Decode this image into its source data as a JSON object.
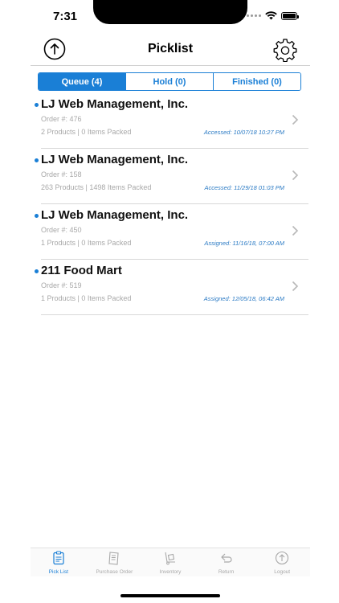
{
  "status_bar": {
    "time": "7:31"
  },
  "nav": {
    "title": "Picklist",
    "left_icon": "upload-icon",
    "right_icon": "gear-icon"
  },
  "segments": [
    {
      "label": "Queue (4)",
      "active": true
    },
    {
      "label": "Hold (0)",
      "active": false
    },
    {
      "label": "Finished (0)",
      "active": false
    }
  ],
  "orders": [
    {
      "name": "LJ Web Management, Inc.",
      "order": "Order #: 476",
      "counts": "2 Products | 0 Items Packed",
      "time": "Accessed: 10/07/18 10:27 PM"
    },
    {
      "name": "LJ Web Management, Inc.",
      "order": "Order #: 158",
      "counts": "263 Products | 1498 Items Packed",
      "time": "Accessed: 11/29/18 01:03 PM"
    },
    {
      "name": "LJ Web Management, Inc.",
      "order": "Order #: 450",
      "counts": "1 Products | 0 Items Packed",
      "time": "Assigned: 11/16/18, 07:00 AM"
    },
    {
      "name": "211 Food Mart",
      "order": "Order #: 519",
      "counts": "1 Products | 0 Items Packed",
      "time": "Assigned: 12/05/18, 06:42 AM"
    }
  ],
  "tabs": [
    {
      "label": "Pick List",
      "icon": "clipboard-icon",
      "active": true
    },
    {
      "label": "Purchase Order",
      "icon": "receipt-icon",
      "active": false
    },
    {
      "label": "Inventory",
      "icon": "dolly-icon",
      "active": false
    },
    {
      "label": "Return",
      "icon": "return-arrow-icon",
      "active": false
    },
    {
      "label": "Logout",
      "icon": "logout-icon",
      "active": false
    }
  ],
  "colors": {
    "accent": "#1a7fd6",
    "muted_text": "#a8a8a8",
    "timestamp": "#2a7ac4"
  }
}
